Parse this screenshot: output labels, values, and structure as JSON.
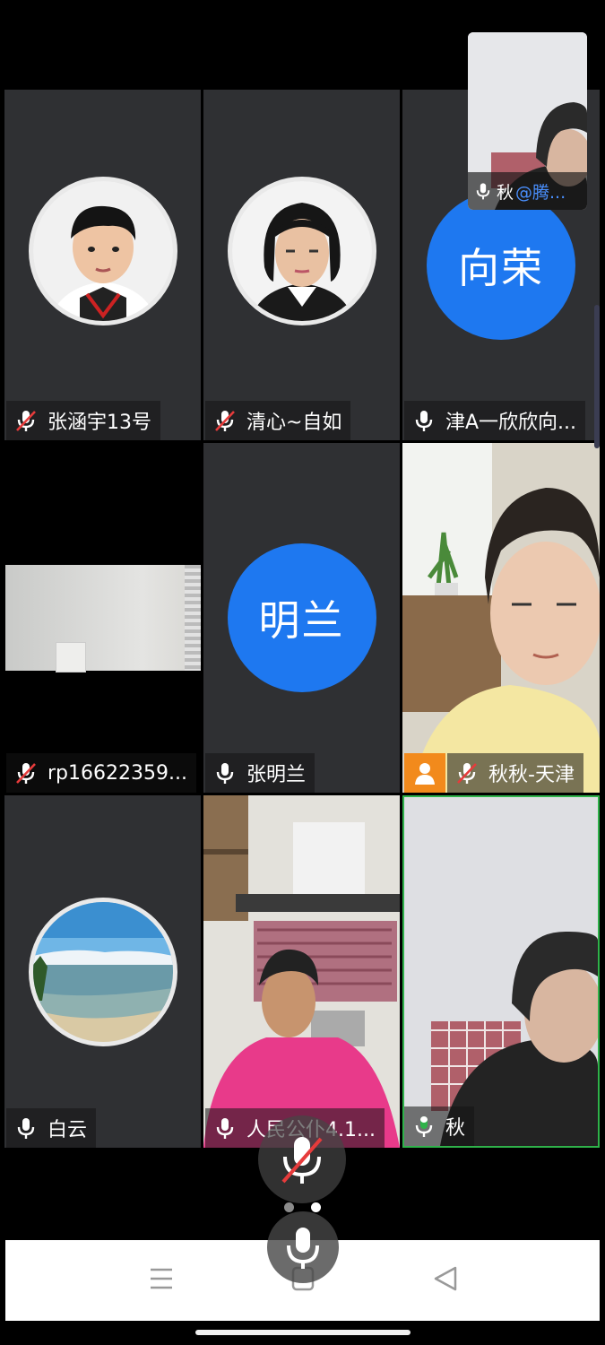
{
  "participants": [
    {
      "name": "张涵宇13号",
      "muted": true,
      "avatar": "photo-boy"
    },
    {
      "name": "清心~自如",
      "muted": true,
      "avatar": "photo-woman"
    },
    {
      "name": "津A一欣欣向...",
      "muted": false,
      "avatar_text": "向荣"
    },
    {
      "name": "rp16622359...",
      "muted": true,
      "avatar": "video"
    },
    {
      "name": "张明兰",
      "muted": false,
      "avatar_text": "明兰"
    },
    {
      "name": "秋秋-天津",
      "muted": true,
      "avatar": "video",
      "host": true
    },
    {
      "name": "白云",
      "muted": false,
      "avatar": "photo-sea"
    },
    {
      "name": "人民公仆4.1...",
      "muted": false,
      "avatar": "video"
    },
    {
      "name": "秋",
      "muted": false,
      "avatar": "video",
      "speaking": true
    }
  ],
  "floating_self_view": {
    "name": "秋",
    "handle": "@腾..."
  },
  "colors": {
    "accent": "#1e78f0",
    "speaking": "#2fb24a",
    "host_badge": "#f28a1c",
    "muted_red": "#e63b3b"
  },
  "icons": {
    "mic": "mic-icon",
    "mic_muted": "mic-muted-icon",
    "host": "host-person-icon"
  },
  "nav": {
    "recent": "recents-icon",
    "home": "home-icon",
    "back": "back-icon"
  }
}
